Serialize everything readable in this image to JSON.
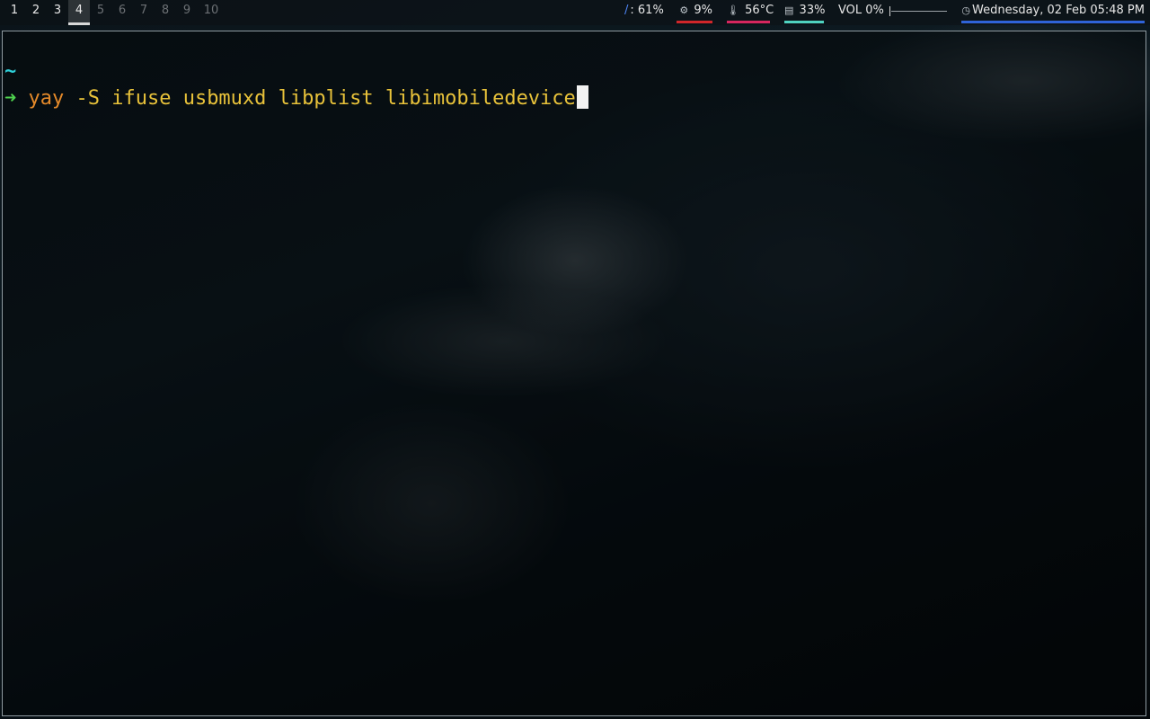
{
  "workspaces": [
    {
      "label": "1",
      "state": "occupied"
    },
    {
      "label": "2",
      "state": "occupied"
    },
    {
      "label": "3",
      "state": "occupied"
    },
    {
      "label": "4",
      "state": "active"
    },
    {
      "label": "5",
      "state": "empty"
    },
    {
      "label": "6",
      "state": "empty"
    },
    {
      "label": "7",
      "state": "empty"
    },
    {
      "label": "8",
      "state": "empty"
    },
    {
      "label": "9",
      "state": "empty"
    },
    {
      "label": "10",
      "state": "empty"
    }
  ],
  "status": {
    "disk": {
      "icon": "disk-root-icon",
      "glyph": "/:",
      "value": "61%"
    },
    "cpu": {
      "icon": "cpu-icon",
      "value": "9%",
      "color": "#d0262a"
    },
    "temperature": {
      "icon": "thermometer-icon",
      "value": "56°C",
      "color": "#d6265e"
    },
    "memory": {
      "icon": "memory-icon",
      "value": "33%",
      "color": "#4fd3c0"
    },
    "volume": {
      "label": "VOL",
      "value": "0%",
      "level": 0
    },
    "clock": {
      "icon": "clock-icon",
      "value": "Wednesday, 02 Feb 05:48 PM",
      "color": "#2f63d8"
    }
  },
  "terminal": {
    "cwd": "~",
    "prompt_symbol": "➜",
    "command": "yay",
    "arguments": " -S ifuse usbmuxd libplist libimobiledevice",
    "colors": {
      "cwd": "#2fd0d9",
      "prompt": "#4fd24f",
      "command": "#e58a2a",
      "arguments": "#e8c23a"
    }
  }
}
